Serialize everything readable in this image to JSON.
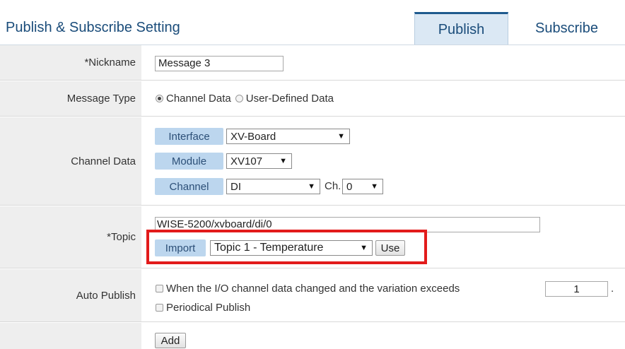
{
  "header": {
    "title": "Publish & Subscribe Setting",
    "tabs": [
      {
        "label": "Publish",
        "active": true
      },
      {
        "label": "Subscribe",
        "active": false
      }
    ]
  },
  "form": {
    "nickname": {
      "label": "*Nickname",
      "value": "Message 3"
    },
    "message_type": {
      "label": "Message Type",
      "options": [
        {
          "label": "Channel Data",
          "selected": true
        },
        {
          "label": "User-Defined Data",
          "selected": false
        }
      ]
    },
    "channel_data": {
      "label": "Channel Data",
      "interface": {
        "label": "Interface",
        "value": "XV-Board"
      },
      "module": {
        "label": "Module",
        "value": "XV107"
      },
      "channel": {
        "label": "Channel",
        "value": "DI",
        "ch_label": "Ch.",
        "ch_value": "0"
      }
    },
    "topic": {
      "label": "*Topic",
      "value": "WISE-5200/xvboard/di/0",
      "import_label": "Import",
      "import_value": "Topic 1 - Temperature",
      "use_label": "Use"
    },
    "auto_publish": {
      "label": "Auto Publish",
      "option1": "When the I/O channel data changed and the variation exceeds",
      "variation_value": "1",
      "option2": "Periodical Publish",
      "trailing": "."
    },
    "add_button": "Add"
  },
  "icons": {
    "dropdown_arrow": "▼"
  },
  "colors": {
    "accent_blue": "#1a4c7a",
    "chip_blue": "#bcd6ee",
    "highlight_red": "#e21b1b",
    "label_bg": "#eeeeee"
  }
}
